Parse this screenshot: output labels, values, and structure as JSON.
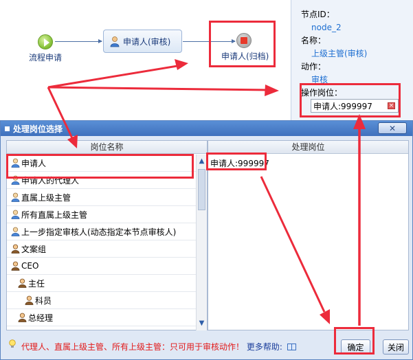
{
  "workflow": {
    "start_label": "流程申请",
    "task_label": "申请人(审核)",
    "end_label": "申请人(归档)"
  },
  "properties": {
    "node_id_key": "节点ID：",
    "node_id_value": "node_2",
    "name_key": "名称：",
    "name_value": "上级主管(审核)",
    "action_key": "动作：",
    "action_value": "审核",
    "position_key": "操作岗位：",
    "position_value": "申请人:999997"
  },
  "dialog": {
    "title": "处理岗位选择",
    "close_glyph": "✕",
    "left_header": "岗位名称",
    "right_header": "处理岗位",
    "positions": [
      {
        "label": "申请人",
        "icon": "person-icon",
        "indent": 0
      },
      {
        "label": "申请人的代理人",
        "icon": "person-icon",
        "indent": 0
      },
      {
        "label": "直属上级主管",
        "icon": "person-icon",
        "indent": 0
      },
      {
        "label": "所有直属上级主管",
        "icon": "person-icon",
        "indent": 0
      },
      {
        "label": "上一步指定审核人(动态指定本节点审核人)",
        "icon": "person-icon",
        "indent": 0
      },
      {
        "label": "文案组",
        "icon": "group-icon",
        "indent": 0
      },
      {
        "label": "CEO",
        "icon": "group-icon",
        "indent": 0
      },
      {
        "label": "主任",
        "icon": "group-icon",
        "indent": 1
      },
      {
        "label": "科员",
        "icon": "group-icon",
        "indent": 2
      },
      {
        "label": "总经理",
        "icon": "group-icon",
        "indent": 1
      }
    ],
    "selected": [
      "申请人:999997"
    ],
    "hint": "代理人、直属上级主管、所有上级主管：只可用于审核动作！",
    "help_link": "更多帮助:",
    "ok_label": "确定",
    "close_label": "关闭"
  },
  "colors": {
    "annotation": "#ec2b3b",
    "title_bar": "#4a80c8",
    "link_blue": "#1e6fd1"
  }
}
